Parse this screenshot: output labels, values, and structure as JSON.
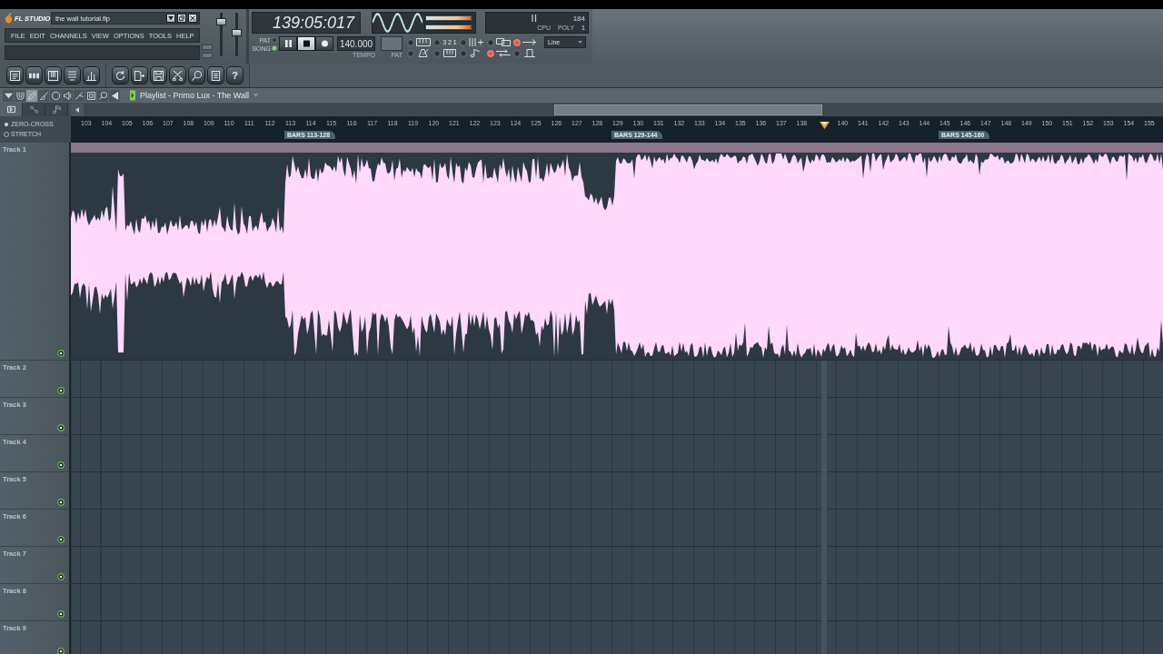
{
  "window": {
    "app": "FL STUDIO",
    "title": "the wall tutorial.flp",
    "controls": [
      {
        "kind": "minimize"
      },
      {
        "kind": "restore"
      },
      {
        "kind": "close"
      }
    ]
  },
  "menu": [
    "FILE",
    "EDIT",
    "CHANNELS",
    "VIEW",
    "OPTIONS",
    "TOOLS",
    "HELP"
  ],
  "sliders": [
    {
      "level": 0.85
    },
    {
      "level": 0.55
    }
  ],
  "transport": {
    "time": "139:05:017",
    "modes": [
      {
        "label": "PAT",
        "selected": false
      },
      {
        "label": "SONG",
        "selected": true
      }
    ],
    "buttons": [
      {
        "kind": "pause",
        "selected": false
      },
      {
        "kind": "stop",
        "selected": true
      },
      {
        "kind": "record",
        "selected": false
      }
    ],
    "tempo": "140.000",
    "tempo_label": "TEMPO",
    "pattern_label": "PAT"
  },
  "meters": [
    {
      "level": 0.97
    },
    {
      "level": 0.97
    }
  ],
  "monitor": {
    "memory": "184",
    "cpu_label": "CPU",
    "poly_label": "POLY",
    "poly": "1"
  },
  "toggles": [
    {
      "kind": "typing-keyboard",
      "on": false
    },
    {
      "kind": "countdown",
      "label": "3 2 1",
      "on": false
    },
    {
      "kind": "step-edit",
      "on": false
    },
    {
      "kind": "blend",
      "on": false
    },
    {
      "kind": "loop-record",
      "on": true
    },
    {
      "kind": "metronome",
      "on": false
    },
    {
      "kind": "piano",
      "on": false
    },
    {
      "kind": "note",
      "on": false
    },
    {
      "kind": "arrows",
      "on": true
    },
    {
      "kind": "wait",
      "on": false
    }
  ],
  "snap": {
    "value": "Line"
  },
  "toolbar": [
    {
      "buttons": [
        {
          "kind": "playlist"
        },
        {
          "kind": "step-sequencer"
        },
        {
          "kind": "piano-roll"
        },
        {
          "kind": "browser"
        },
        {
          "kind": "mixer"
        }
      ]
    },
    {
      "buttons": [
        {
          "kind": "undo"
        },
        {
          "kind": "export"
        },
        {
          "kind": "disk"
        },
        {
          "kind": "cross"
        },
        {
          "kind": "zoom"
        },
        {
          "kind": "document"
        },
        {
          "kind": "help",
          "label": "?"
        }
      ]
    }
  ],
  "playlist": {
    "title": "Playlist - Primo Lux - The Wall",
    "tools": [
      {
        "kind": "menu",
        "selected": false
      },
      {
        "kind": "magnet",
        "selected": false
      },
      {
        "kind": "pencil",
        "selected": true
      },
      {
        "kind": "brush",
        "selected": false
      },
      {
        "kind": "mute",
        "selected": false
      },
      {
        "kind": "speaker",
        "selected": false
      },
      {
        "kind": "slice",
        "selected": false
      },
      {
        "kind": "select",
        "selected": false
      },
      {
        "kind": "zoom",
        "selected": false
      },
      {
        "kind": "play",
        "selected": false
      }
    ],
    "tabs": [
      {
        "kind": "arrangement",
        "selected": true
      },
      {
        "kind": "pattern",
        "selected": false
      },
      {
        "kind": "note",
        "selected": false
      }
    ],
    "options": [
      {
        "label": "ZERO-CROSS",
        "checked": true
      },
      {
        "label": "STRETCH",
        "checked": false
      }
    ],
    "ruler": [
      {
        "kind": "bar",
        "label": "103"
      },
      {
        "kind": "bar",
        "label": "104"
      },
      {
        "kind": "bar",
        "label": "105"
      },
      {
        "kind": "bar",
        "label": "106"
      },
      {
        "kind": "bar",
        "label": "107"
      },
      {
        "kind": "bar",
        "label": "108"
      },
      {
        "kind": "bar",
        "label": "109"
      },
      {
        "kind": "bar",
        "label": "110"
      },
      {
        "kind": "bar",
        "label": "111"
      },
      {
        "kind": "bar",
        "label": "112"
      },
      {
        "kind": "bar",
        "label": "113",
        "marker": "BARS 113-128"
      },
      {
        "kind": "bar",
        "label": "114"
      },
      {
        "kind": "bar",
        "label": "115"
      },
      {
        "kind": "bar",
        "label": "116"
      },
      {
        "kind": "bar",
        "label": "117"
      },
      {
        "kind": "bar",
        "label": "118"
      },
      {
        "kind": "bar",
        "label": "119"
      },
      {
        "kind": "bar",
        "label": "120"
      },
      {
        "kind": "bar",
        "label": "121"
      },
      {
        "kind": "bar",
        "label": "122"
      },
      {
        "kind": "bar",
        "label": "123"
      },
      {
        "kind": "bar",
        "label": "124"
      },
      {
        "kind": "bar",
        "label": "125"
      },
      {
        "kind": "bar",
        "label": "126"
      },
      {
        "kind": "bar",
        "label": "127"
      },
      {
        "kind": "bar",
        "label": "128"
      },
      {
        "kind": "bar",
        "label": "129",
        "marker": "BARS 129-144"
      },
      {
        "kind": "bar",
        "label": "130"
      },
      {
        "kind": "bar",
        "label": "131"
      },
      {
        "kind": "bar",
        "label": "132"
      },
      {
        "kind": "bar",
        "label": "133"
      },
      {
        "kind": "bar",
        "label": "134"
      },
      {
        "kind": "bar",
        "label": "135"
      },
      {
        "kind": "bar",
        "label": "136"
      },
      {
        "kind": "bar",
        "label": "137"
      },
      {
        "kind": "bar",
        "label": "138"
      },
      {
        "kind": "playhead"
      },
      {
        "kind": "bar",
        "label": "140"
      },
      {
        "kind": "bar",
        "label": "141"
      },
      {
        "kind": "bar",
        "label": "142"
      },
      {
        "kind": "bar",
        "label": "143"
      },
      {
        "kind": "bar",
        "label": "144"
      },
      {
        "kind": "bar",
        "label": "145",
        "marker": "BARS 145-160"
      },
      {
        "kind": "bar",
        "label": "146"
      },
      {
        "kind": "bar",
        "label": "147"
      },
      {
        "kind": "bar",
        "label": "148"
      },
      {
        "kind": "bar",
        "label": "149"
      },
      {
        "kind": "bar",
        "label": "150"
      },
      {
        "kind": "bar",
        "label": "151"
      },
      {
        "kind": "bar",
        "label": "152"
      },
      {
        "kind": "bar",
        "label": "153"
      },
      {
        "kind": "bar",
        "label": "154"
      },
      {
        "kind": "bar",
        "label": "155"
      }
    ],
    "tracks": [
      {
        "name": "Track 1",
        "kind": "audio",
        "on": true
      },
      {
        "name": "Track 2",
        "kind": "empty",
        "on": true
      },
      {
        "name": "Track 3",
        "kind": "empty",
        "on": true
      },
      {
        "name": "Track 4",
        "kind": "empty",
        "on": true
      },
      {
        "name": "Track 5",
        "kind": "empty",
        "on": true
      },
      {
        "name": "Track 6",
        "kind": "empty",
        "on": true
      },
      {
        "name": "Track 7",
        "kind": "empty",
        "on": true
      },
      {
        "name": "Track 8",
        "kind": "empty",
        "on": true
      },
      {
        "name": "Track 9",
        "kind": "empty",
        "on": true
      }
    ]
  }
}
